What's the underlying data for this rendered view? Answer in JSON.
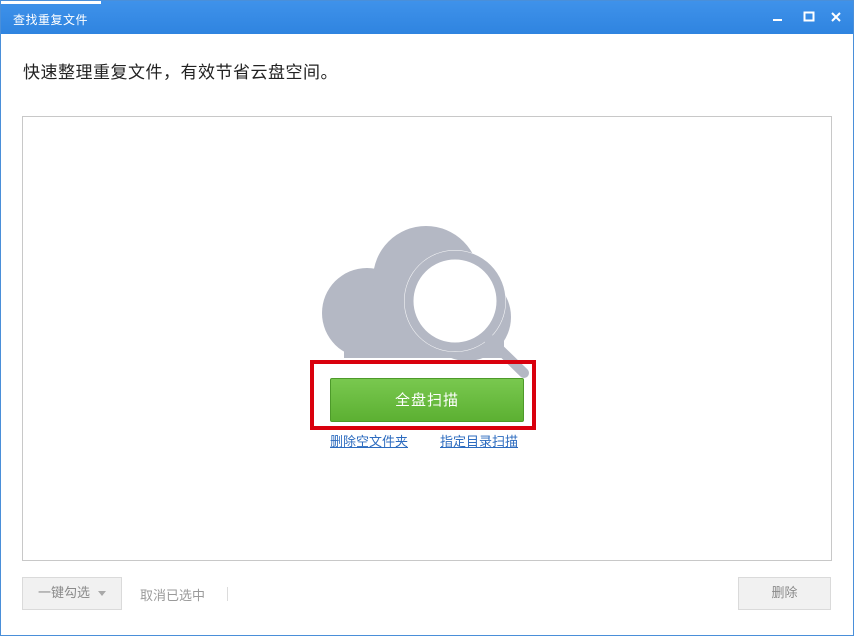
{
  "window": {
    "title": "查找重复文件",
    "controls": [
      "minimize-icon",
      "maximize-icon",
      "close-icon"
    ]
  },
  "header": {
    "subtitle": "快速整理重复文件，有效节省云盘空间。"
  },
  "main": {
    "scan_button_label": "全盘扫描",
    "links": {
      "delete_empty_folders": "删除空文件夹",
      "scan_directory": "指定目录扫描"
    },
    "illustration_icon": "cloud-search-icon"
  },
  "footer": {
    "select_all_label": "一键勾选",
    "deselect_label": "取消已选中",
    "delete_label": "删除"
  },
  "colors": {
    "titlebar": "#2f84e0",
    "primary_button": "#67b83b",
    "highlight": "#d9000d",
    "link": "#2c6bbf",
    "illustration": "#b4b8c4"
  }
}
